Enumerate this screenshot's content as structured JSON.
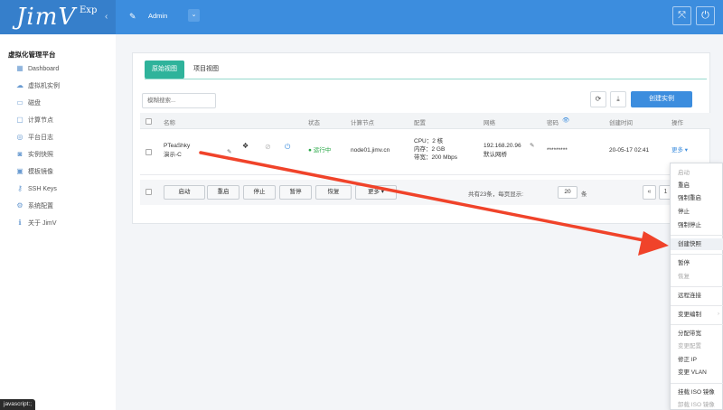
{
  "brand": {
    "name": "JimV",
    "edition": "Exp"
  },
  "header": {
    "user_name": "Admin",
    "expand_icon": "expand-icon",
    "power_icon": "power-icon"
  },
  "sidebar": {
    "title": "虚拟化管理平台",
    "items": [
      {
        "label": "Dashboard",
        "icon": "dashboard-icon"
      },
      {
        "label": "虚拟机实例",
        "icon": "cloud-icon"
      },
      {
        "label": "磁盘",
        "icon": "disk-icon"
      },
      {
        "label": "计算节点",
        "icon": "monitor-icon"
      },
      {
        "label": "平台日志",
        "icon": "eye-icon"
      },
      {
        "label": "实例快照",
        "icon": "camera-icon"
      },
      {
        "label": "模板镜像",
        "icon": "image-icon"
      },
      {
        "label": "SSH Keys",
        "icon": "key-icon"
      },
      {
        "label": "系统配置",
        "icon": "gear-icon"
      },
      {
        "label": "关于 JimV",
        "icon": "info-icon"
      }
    ]
  },
  "tabs": [
    {
      "label": "原始视图"
    },
    {
      "label": "项目视图"
    }
  ],
  "search": {
    "placeholder": "模糊搜索..."
  },
  "toolbar": {
    "create_label": "创建实例"
  },
  "table": {
    "columns": [
      "名称",
      "状态",
      "计算节点",
      "配置",
      "网络",
      "密码",
      "创建时间",
      "操作"
    ],
    "row": {
      "name": "PTeaShky",
      "project": "演示-C",
      "status": "运行中",
      "node": "node01.jimv.cn",
      "cpu": "CPU：2 核",
      "memory": "内存：2 GB",
      "bandwidth": "带宽：200 Mbps",
      "ip": "192.168.20.96",
      "network": "默认网桥",
      "password": "*********",
      "created": "20-05-17 02:41",
      "action": "更多 ▾"
    }
  },
  "footer": {
    "buttons": [
      "启动",
      "重启",
      "停止",
      "暂停",
      "恢复",
      "更多 ▾"
    ],
    "summary_prefix": "共有23条，每页显示:",
    "page_size": "20",
    "summary_suffix": "条",
    "prev": "«",
    "page": "1"
  },
  "menu": {
    "items": [
      {
        "label": "启动",
        "disabled": true
      },
      {
        "label": "重启"
      },
      {
        "label": "强制重启"
      },
      {
        "label": "停止"
      },
      {
        "label": "强制停止"
      },
      {
        "label": "创建快照",
        "highlight": true
      },
      {
        "label": "暂停"
      },
      {
        "label": "恢复",
        "disabled": true
      },
      {
        "label": "远程连接"
      },
      {
        "label": "变更编制",
        "sub": "›"
      },
      {
        "label": "分配带宽"
      },
      {
        "label": "变更配置",
        "disabled": true
      },
      {
        "label": "修正 IP"
      },
      {
        "label": "变更 VLAN"
      },
      {
        "label": "挂载 ISO 镜像"
      },
      {
        "label": "卸载 ISO 镜像",
        "disabled": true
      }
    ]
  },
  "statusbar": "javascript:;",
  "colors": {
    "primary": "#3c8dde",
    "accent": "#2fb39b",
    "arrow": "#f0432a",
    "running": "#27a745"
  }
}
